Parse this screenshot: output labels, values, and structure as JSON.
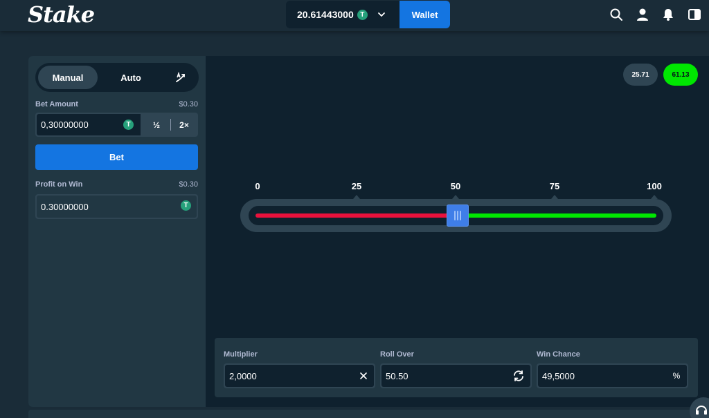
{
  "header": {
    "logo": "Stake",
    "balance": "20.61443000",
    "currency_icon": "tether-coin-icon",
    "wallet_label": "Wallet",
    "icons": [
      "search-icon",
      "user-icon",
      "bell-icon",
      "sidebar-toggle-icon"
    ]
  },
  "sidebar": {
    "tabs": {
      "manual": "Manual",
      "auto": "Auto",
      "advanced_icon": "advanced-bet-icon"
    },
    "bet_amount": {
      "label": "Bet Amount",
      "usd_value": "$0.30",
      "value": "0,30000000",
      "half_label": "½",
      "double_label": "2×"
    },
    "bet_button": "Bet",
    "profit_on_win": {
      "label": "Profit on Win",
      "usd_value": "$0.30",
      "value": "0.30000000"
    }
  },
  "coin_glyph": "T",
  "history": [
    "25.71",
    "61.13"
  ],
  "slider": {
    "ticks": [
      "0",
      "25",
      "50",
      "75",
      "100"
    ],
    "roll_over_value": 50.5,
    "colors": {
      "lose": "#e9113c",
      "win": "#00e701",
      "handle": "#3f7ee8"
    }
  },
  "controls": {
    "multiplier": {
      "label": "Multiplier",
      "value": "2,0000",
      "icon": "close-icon"
    },
    "roll_over": {
      "label": "Roll Over",
      "value": "50.50",
      "icon": "refresh-icon"
    },
    "win_chance": {
      "label": "Win Chance",
      "value": "49,5000",
      "icon": "percent-icon",
      "icon_text": "%"
    }
  },
  "colors": {
    "background": "#1a2c38",
    "panel": "#213743",
    "input": "#0f212e",
    "accent": "#1475e1"
  }
}
